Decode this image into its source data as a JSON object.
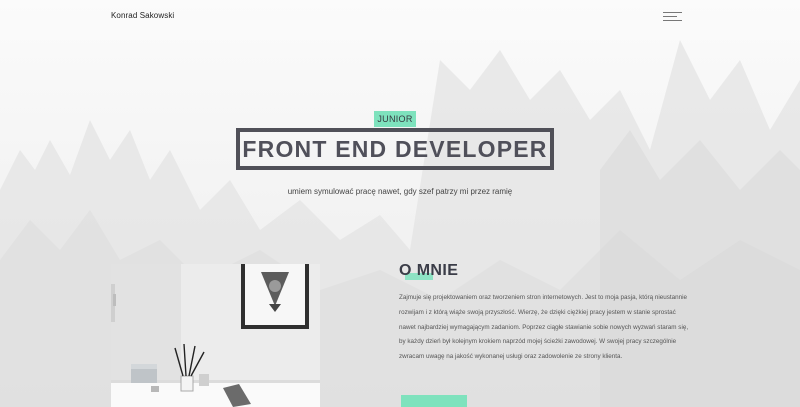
{
  "header": {
    "brand": "Konrad Sakowski",
    "menu_icon": "hamburger-menu-icon"
  },
  "hero": {
    "badge": "JUNIOR",
    "title": "FRONT END DEVELOPER",
    "subtitle": "umiem symulować pracę nawet, gdy szef patrzy mi przez ramię"
  },
  "about": {
    "title": "O MNIE",
    "text": "Zajmuje się projektowaniem oraz tworzeniem stron internetowych. Jest to moja pasja, którą nieustannie rozwijam i z którą wiąże swoją przyszłość. Wierzę, że dzięki ciężkiej pracy jestem w stanie sprostać nawet najbardziej wymagającym zadaniom. Poprzez ciągłe stawianie sobie nowych wyzwań staram się, by każdy dzień był kolejnym krokiem naprzód mojej ścieżki zawodowej. W swojej pracy szczególnie zwracam uwagę na jakość wykonanej usługi oraz zadowolenie ze strony klienta."
  },
  "colors": {
    "accent": "#7ee2bd",
    "title": "#50505a"
  }
}
